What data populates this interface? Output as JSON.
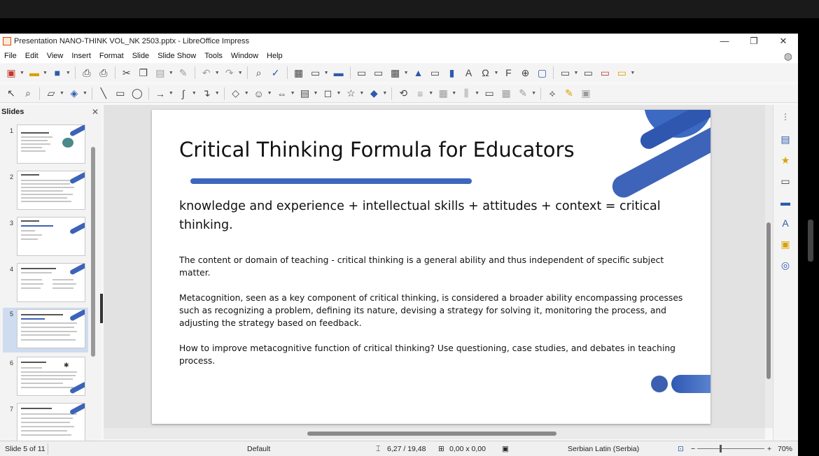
{
  "window": {
    "title": "Presentation NANO-THINK  VOL_NK 2503.pptx - LibreOffice Impress",
    "controls": [
      "—",
      "❐",
      "✕"
    ]
  },
  "menu": [
    "File",
    "Edit",
    "View",
    "Insert",
    "Format",
    "Slide",
    "Slide Show",
    "Tools",
    "Window",
    "Help"
  ],
  "slides_pane": {
    "title": "Slides",
    "thumbnails": [
      {
        "num": "1"
      },
      {
        "num": "2"
      },
      {
        "num": "3"
      },
      {
        "num": "4"
      },
      {
        "num": "5",
        "selected": true
      },
      {
        "num": "6"
      },
      {
        "num": "7"
      }
    ]
  },
  "slide": {
    "title": "Critical Thinking Formula for Educators",
    "formula": "knowledge and experience + intellectual skills + attitudes + context = critical thinking.",
    "paragraphs": [
      "The content or domain of teaching - critical thinking is a general ability and thus independent of specific subject matter.",
      "Metacognition, seen as a key component of critical thinking, is considered a broader ability encompassing processes such as recognizing a problem, defining its nature, devising a strategy for solving it, monitoring the process, and adjusting the strategy based on feedback.",
      "How to improve metacognitive function of critical thinking? Use questioning, case studies, and debates in teaching process."
    ]
  },
  "status": {
    "slide": "Slide 5 of 11",
    "master": "Default",
    "position": "6,27 / 19,48",
    "size": "0,00 x 0,00",
    "language": "Serbian Latin (Serbia)",
    "zoom": "70%"
  },
  "colors": {
    "accent": "#3d66be"
  }
}
